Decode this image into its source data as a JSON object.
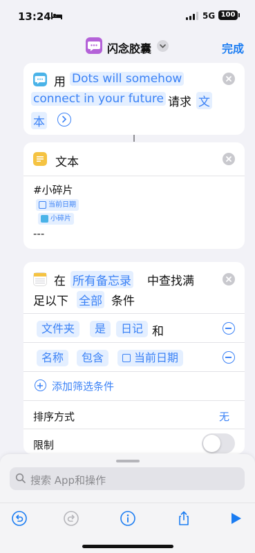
{
  "status_bar": {
    "time": "13:24",
    "network": "5G",
    "battery": "100"
  },
  "nav": {
    "title": "闪念胶囊",
    "done_label": "完成",
    "accent": "#1a7cf2"
  },
  "ask_card": {
    "prefix": "用",
    "prompt_token": "Dots will somehow connect in your future",
    "prompt_line1": "Dots will somehow",
    "prompt_line2": "connect in your future",
    "middle": "请求",
    "type_token_line1": "文",
    "type_token_line2": "本"
  },
  "text_card": {
    "title": "文本",
    "line1": "#小碎片",
    "token_date": "当前日期",
    "token_snippet": "小碎片",
    "line4": "---"
  },
  "find_card": {
    "prefix": "在",
    "source_token": "所有备忘录",
    "middle": "中查找满",
    "line2_prefix": "足以下",
    "match_token": "全部",
    "line2_suffix": "条件",
    "filters": [
      {
        "field": "文件夹",
        "op": "是",
        "value": "日记",
        "joiner": "和"
      },
      {
        "field": "名称",
        "op": "包含",
        "value": "当前日期"
      }
    ],
    "add_filter_label": "添加筛选条件",
    "sort_label": "排序方式",
    "sort_value": "无",
    "limit_label": "限制",
    "limit_enabled": false
  },
  "sheet": {
    "search_placeholder": "搜索 App和操作"
  },
  "colors": {
    "token_text": "#3b82f6",
    "token_bg": "#e4efff",
    "shortcut_purple": "#b462d8"
  }
}
